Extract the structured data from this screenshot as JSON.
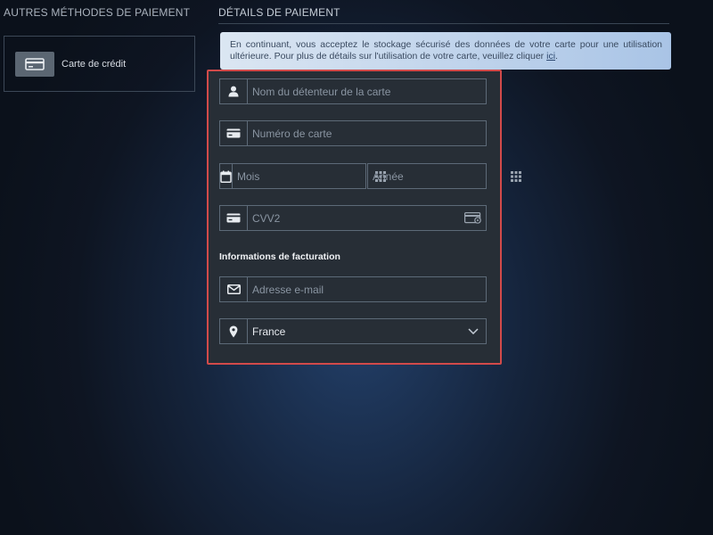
{
  "left": {
    "heading": "AUTRES MÉTHODES DE PAIEMENT",
    "methods": [
      {
        "label": "Carte de crédit",
        "icon": "credit-card-icon"
      }
    ]
  },
  "right": {
    "heading": "DÉTAILS DE PAIEMENT",
    "notice": {
      "text": "En continuant, vous acceptez le stockage sécurisé des données de votre carte pour une utilisation ultérieure. Pour plus de détails sur l'utilisation de votre carte, veuillez cliquer ",
      "link": "ici",
      "suffix": "."
    }
  },
  "form": {
    "cardholder_placeholder": "Nom du détenteur de la carte",
    "card_number_placeholder": "Numéro de carte",
    "month_placeholder": "Mois",
    "year_placeholder": "Année",
    "cvv_placeholder": "CVV2",
    "billing_title": "Informations de facturation",
    "email_placeholder": "Adresse e-mail",
    "country_value": "France"
  },
  "colors": {
    "frame_border": "#d24a4a",
    "form_bg": "#272e36",
    "field_border": "#5d6a78",
    "notice_bg": "#dbe6f2"
  }
}
